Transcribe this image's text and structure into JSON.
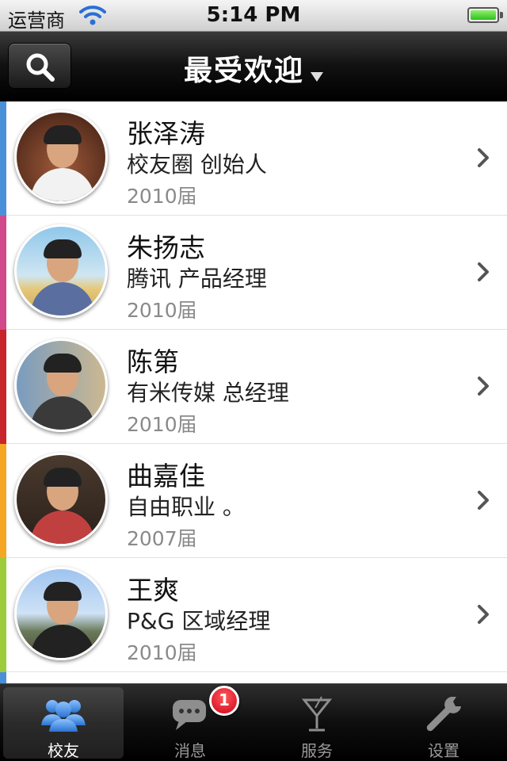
{
  "status_bar": {
    "carrier": "运营商",
    "time": "5:14 PM",
    "battery_percent": 100
  },
  "nav": {
    "title": "最受欢迎"
  },
  "alumni": [
    {
      "name": "张泽涛",
      "title": "校友圈 创始人",
      "year": "2010届",
      "strip_color": "#4a90d9"
    },
    {
      "name": "朱扬志",
      "title": "腾讯 产品经理",
      "year": "2010届",
      "strip_color": "#d04a8c"
    },
    {
      "name": "陈第",
      "title": "有米传媒 总经理",
      "year": "2010届",
      "strip_color": "#c8242b"
    },
    {
      "name": "曲嘉佳",
      "title": "自由职业 。",
      "year": "2007届",
      "strip_color": "#f5a623"
    },
    {
      "name": "王爽",
      "title": "P&G 区域经理",
      "year": "2010届",
      "strip_color": "#9ccc3c"
    }
  ],
  "tabs": [
    {
      "label": "校友",
      "icon": "people-icon",
      "active": true
    },
    {
      "label": "消息",
      "icon": "chat-bubble-icon",
      "badge": "1"
    },
    {
      "label": "服务",
      "icon": "cocktail-glass-icon"
    },
    {
      "label": "设置",
      "icon": "wrench-icon"
    }
  ],
  "colors": {
    "nav_background": "#000000",
    "badge": "#d0021b",
    "tab_active_icon": "#4a90d9"
  }
}
